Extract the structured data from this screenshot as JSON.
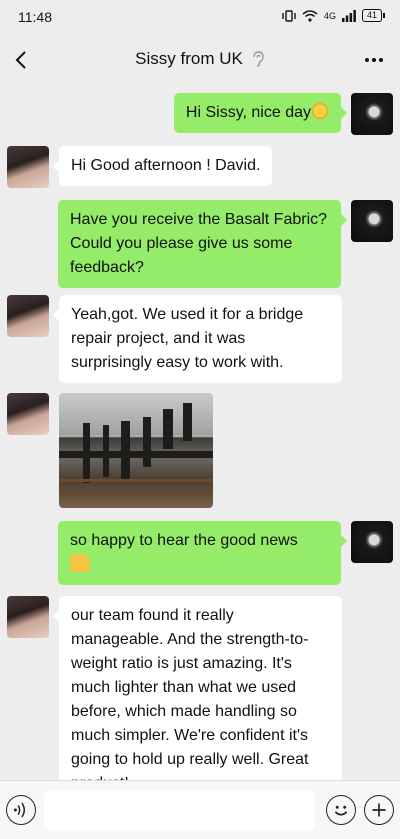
{
  "status_bar": {
    "time": "11:48",
    "network": "4G",
    "battery": "41"
  },
  "header": {
    "title": "Sissy from UK",
    "back_icon": "chevron-left-icon",
    "more_icon": "more-dots-icon",
    "muted_icon": "ear-icon"
  },
  "messages": [
    {
      "sender": "me",
      "type": "text",
      "text": "Hi Sissy, nice day",
      "emoji": "sun-emoji"
    },
    {
      "sender": "contact",
      "type": "text",
      "text": "Hi Good afternoon ! David."
    },
    {
      "sender": "me",
      "type": "text",
      "text": "Have you receive the Basalt Fabric?Could you please give us some feedback?"
    },
    {
      "sender": "contact",
      "type": "text",
      "text": "Yeah,got. We used it for a bridge repair project, and it was surprisingly easy to work with."
    },
    {
      "sender": "contact",
      "type": "image",
      "image": "bridge-repair-photo"
    },
    {
      "sender": "me",
      "type": "text",
      "text": "so happy to hear the good news",
      "emoji": "thumbs-up-emoji"
    },
    {
      "sender": "contact",
      "type": "text",
      "text": "our team found it really manageable. And the strength-to-weight ratio is just amazing. It's much lighter than what we used before, which made handling so much simpler. We're confident it's going to hold up really well. Great product!"
    }
  ],
  "input_bar": {
    "voice_icon": "voice-input-icon",
    "text_value": "",
    "emoji_icon": "emoji-icon",
    "plus_icon": "plus-icon"
  },
  "colors": {
    "background": "#ededed",
    "outgoing_bubble": "#95ec69",
    "incoming_bubble": "#ffffff"
  }
}
